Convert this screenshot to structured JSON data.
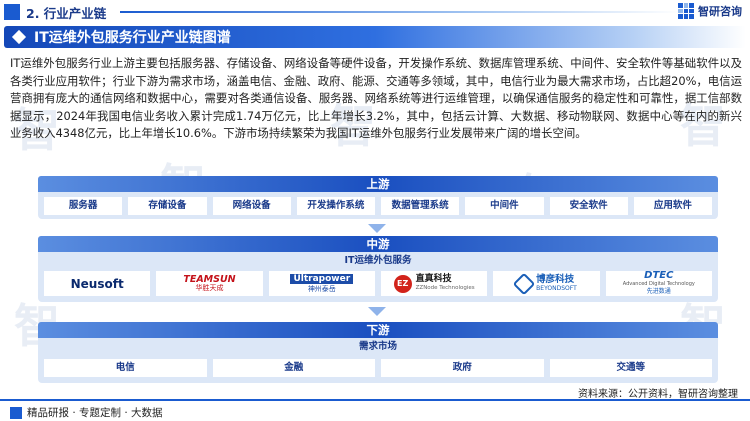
{
  "header": {
    "section_label": "2. 行业产业链",
    "brand_name": "智研咨询"
  },
  "title": "IT运维外包服务行业产业链图谱",
  "paragraph": "IT运维外包服务行业上游主要包括服务器、存储设备、网络设备等硬件设备，开发操作系统、数据库管理系统、中间件、安全软件等基础软件以及各类行业应用软件；行业下游为需求市场，涵盖电信、金融、政府、能源、交通等多领域，其中，电信行业为最大需求市场，占比超20%，电信运营商拥有庞大的通信网络和数据中心，需要对各类通信设备、服务器、网络系统等进行运维管理，以确保通信服务的稳定性和可靠性，据工信部数据显示，2024年我国电信业务收入累计完成1.74万亿元，比上年增长3.2%，其中，包括云计算、大数据、移动物联网、数据中心等在内的新兴业务收入4348亿元，比上年增长10.6%。下游市场持续繁荣为我国IT运维外包服务行业发展带来广阔的增长空间。",
  "upstream": {
    "label": "上游",
    "items": [
      "服务器",
      "存储设备",
      "网络设备",
      "开发操作系统",
      "数据管理系统",
      "中间件",
      "安全软件",
      "应用软件"
    ]
  },
  "midstream": {
    "label": "中游",
    "sublabel": "IT运维外包服务",
    "logos": {
      "neusoft": "Neusoft",
      "teamsun_en": "TEAMSUN",
      "teamsun_cn": "华胜天成",
      "ultrapower_en": "Ultrapower",
      "ultrapower_cn": "神州泰岳",
      "ezz_mark": "EZ",
      "ezz_cn": "直真科技",
      "ezz_en": "ZZNode Technologies",
      "beyondsoft_cn": "博彦科技",
      "beyondsoft_en": "BEYONDSOFT",
      "dtec_en": "DTEC",
      "dtec_tag": "Advanced Digital Technology",
      "dtec_cn": "先进数通"
    }
  },
  "downstream": {
    "label": "下游",
    "sublabel": "需求市场",
    "items": [
      "电信",
      "金融",
      "政府",
      "交通等"
    ]
  },
  "source": "资料来源：公开资料，智研咨询整理",
  "footer": "精品研报 · 专题定制 · 大数据",
  "watermark": "智"
}
